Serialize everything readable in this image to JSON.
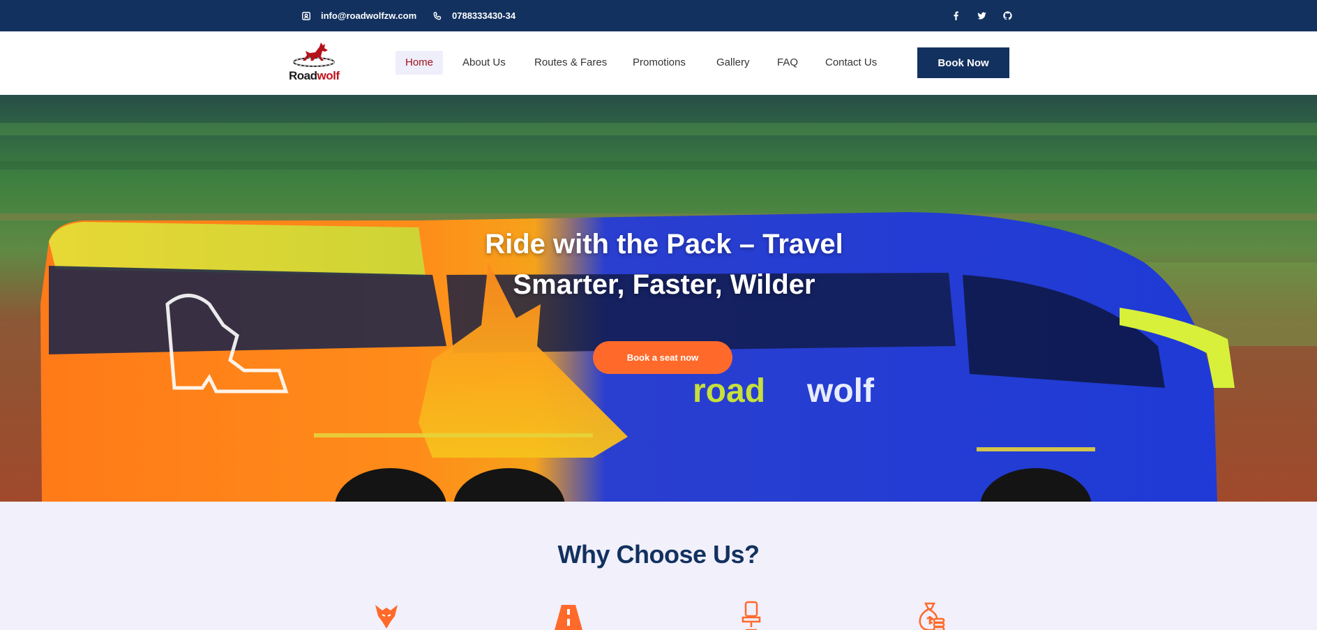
{
  "topbar": {
    "email": "info@roadwolfzw.com",
    "phone": "0788333430-34",
    "email_icon": "contact-card-icon",
    "phone_icon": "phone-icon",
    "social": [
      "facebook-icon",
      "twitter-icon",
      "github-icon"
    ]
  },
  "brand": {
    "name_part1": "Road",
    "name_part2": "wolf"
  },
  "nav": {
    "items": [
      "Home",
      "About Us",
      "Routes & Fares",
      "Promotions",
      "Gallery",
      "FAQ",
      "Contact Us"
    ],
    "active": "Home",
    "cta": "Book Now"
  },
  "hero": {
    "title_line1": "Ride with the Pack – Travel",
    "title_line2": "Smarter, Faster, Wilder",
    "button": "Book a seat now",
    "bus_brand_part1": "road",
    "bus_brand_part2": "wolf"
  },
  "why": {
    "title": "Why Choose Us?",
    "icons": [
      "wolf-icon",
      "road-icon",
      "seat-icon",
      "money-bag-icon"
    ]
  },
  "colors": {
    "navy": "#12315f",
    "accent_orange": "#ff6a2b",
    "logo_red": "#c0121c",
    "section_bg": "#f1f0fb"
  }
}
